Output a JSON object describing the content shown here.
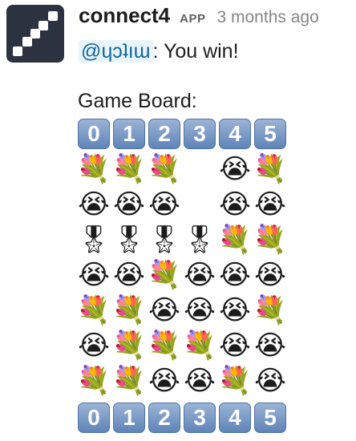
{
  "message": {
    "app_name": "connect4",
    "app_badge": "APP",
    "timestamp": "3 months ago",
    "mention": "@ɥɔʇıɯ",
    "text": ": You win!",
    "board_title": "Game Board:"
  },
  "board": {
    "column_labels": [
      "0",
      "1",
      "2",
      "3",
      "4",
      "5"
    ],
    "rows": [
      [
        "💐",
        "💐",
        "💐",
        "",
        "😭",
        "💐"
      ],
      [
        "😭",
        "😭",
        "😭",
        "",
        "😭",
        "😭"
      ],
      [
        "🎖",
        "🎖",
        "🎖",
        "🎖",
        "💐",
        "💐"
      ],
      [
        "😭",
        "😭",
        "💐",
        "😭",
        "😭",
        "😭"
      ],
      [
        "💐",
        "💐",
        "😭",
        "😭",
        "😭",
        "💐"
      ],
      [
        "😭",
        "💐",
        "💐",
        "💐",
        "😭",
        "😭"
      ],
      [
        "💐",
        "💐",
        "😭",
        "😭",
        "💐",
        "😭"
      ]
    ]
  },
  "icons": {
    "avatar": "dice-five-icon"
  },
  "colors": {
    "mention_text": "#1264a3",
    "mention_bg": "#e8f5fa",
    "avatar_bg": "#2d3240",
    "keycap": "#6b8fc0"
  }
}
